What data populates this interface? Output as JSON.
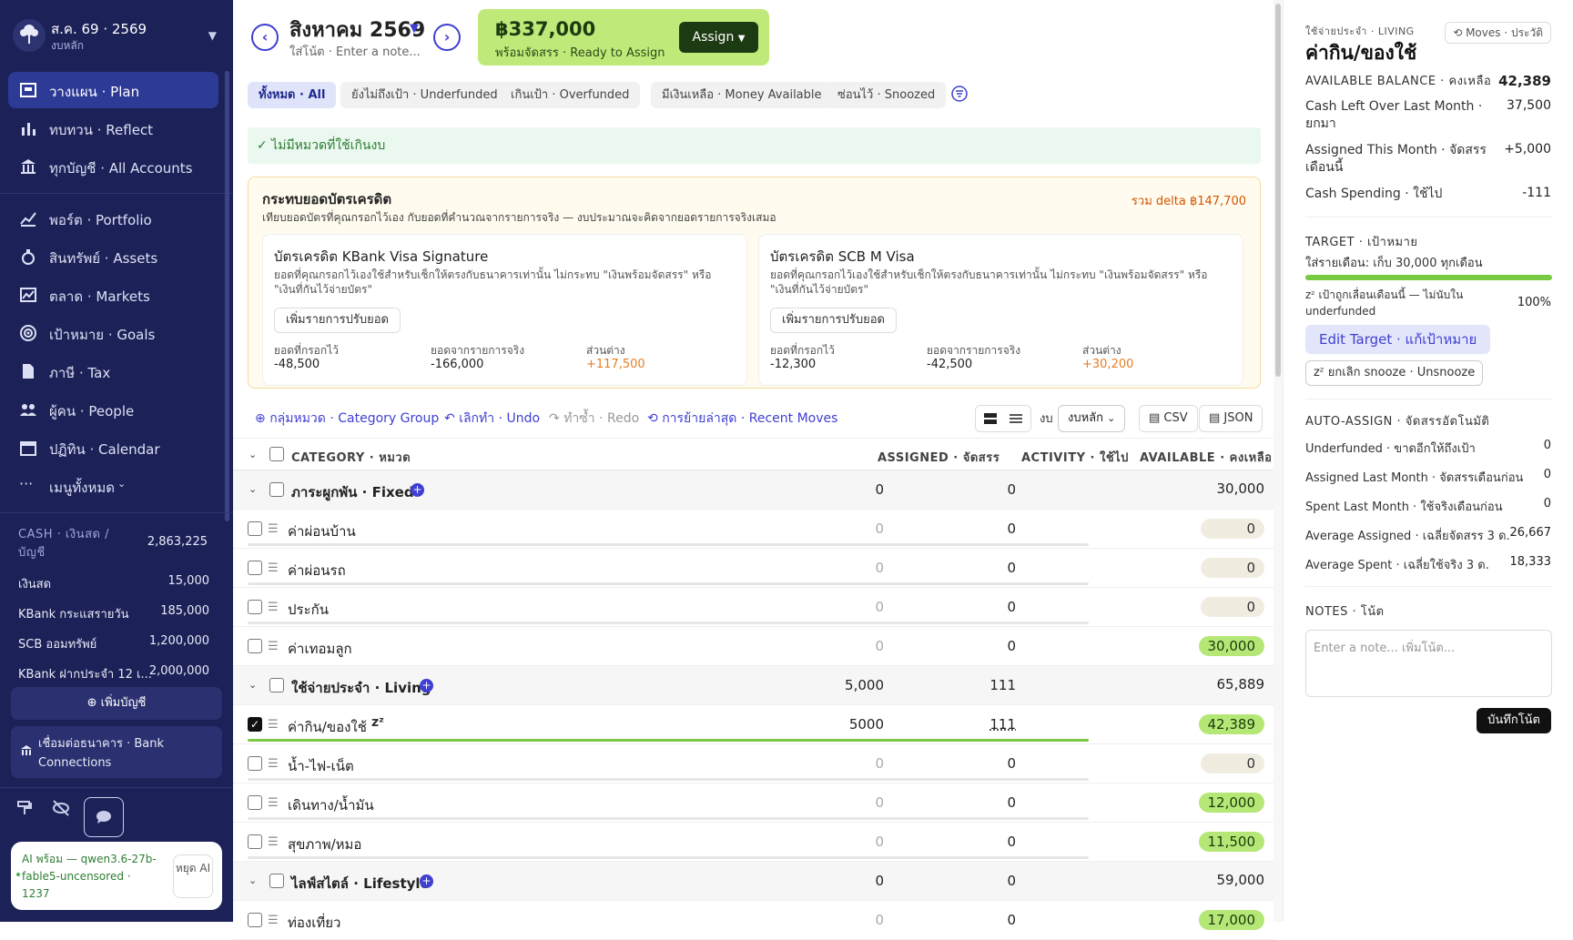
{
  "sidebar": {
    "budget_title": "ส.ค. 69 · 2569",
    "budget_sub": "งบหลัก",
    "nav_main": [
      {
        "label": "วางแผน · Plan",
        "icon": "plan-icon",
        "active": true
      },
      {
        "label": "ทบทวน · Reflect",
        "icon": "reflect-icon"
      },
      {
        "label": "ทุกบัญชี · All Accounts",
        "icon": "bank-icon"
      }
    ],
    "nav_more": [
      {
        "label": "พอร์ต · Portfolio",
        "icon": "portfolio-icon"
      },
      {
        "label": "สินทรัพย์ · Assets",
        "icon": "assets-icon"
      },
      {
        "label": "ตลาด · Markets",
        "icon": "markets-icon"
      },
      {
        "label": "เป้าหมาย · Goals",
        "icon": "goals-icon"
      },
      {
        "label": "ภาษี · Tax",
        "icon": "tax-icon"
      },
      {
        "label": "ผู้คน · People",
        "icon": "people-icon"
      },
      {
        "label": "ปฏิทิน · Calendar",
        "icon": "calendar-icon"
      },
      {
        "label": "เมนูทั้งหมด",
        "icon": "more-icon"
      }
    ],
    "cash_header": "CASH · เงินสด / บัญชี",
    "cash_total": "2,863,225",
    "accounts": [
      {
        "name": "เงินสด",
        "value": "15,000"
      },
      {
        "name": "KBank กระแสรายวัน",
        "value": "185,000"
      },
      {
        "name": "SCB ออมทรัพย์",
        "value": "1,200,000"
      },
      {
        "name": "KBank ฝากประจำ 12 เ...",
        "value": "2,000,000"
      }
    ],
    "add_account": "เพิ่มบัญชี",
    "bank_connections": "เชื่อมต่อธนาคาร · Bank Connections",
    "ai_status": "AI พร้อม — qwen3.6-27b-fable5-uncensored · 1237",
    "ai_stop": "หยุด AI"
  },
  "header": {
    "month": "สิงหาคม 2569",
    "note_placeholder": "ใส่โน้ต · Enter a note...",
    "ready_amount": "฿337,000",
    "ready_label": "พร้อมจัดสรร · Ready to Assign",
    "assign_label": "Assign"
  },
  "filters": [
    "ทั้งหมด · All",
    "ยังไม่ถึงเป้า · Underfunded",
    "เกินเป้า · Overfunded",
    "มีเงินเหลือ · Money Available",
    "ซ่อนไว้ · Snoozed"
  ],
  "ok_message": "✓ ไม่มีหมวดที่ใช้เกินงบ",
  "cc_section": {
    "title": "กระทบยอดบัตรเครดิต",
    "subtitle": "เทียบยอดบัตรที่คุณกรอกไว้เอง กับยอดที่คำนวณจากรายการจริง — งบประมาณจะคิดจากยอดรายการจริงเสมอ",
    "total_delta": "รวม delta ฿147,700",
    "cards": [
      {
        "name": "บัตรเครดิต KBank Visa Signature",
        "desc": "ยอดที่คุณกรอกไว้เองใช้สำหรับเช็กให้ตรงกับธนาคารเท่านั้น ไม่กระทบ \"เงินพร้อมจัดสรร\" หรือ \"เงินที่กันไว้จ่ายบัตร\"",
        "btn": "เพิ่มรายการปรับยอด",
        "k1": "ยอดที่กรอกไว้",
        "v1": "-48,500",
        "k2": "ยอดจากรายการจริง",
        "v2": "-166,000",
        "k3": "ส่วนต่าง",
        "v3": "+117,500"
      },
      {
        "name": "บัตรเครดิต SCB M Visa",
        "desc": "ยอดที่คุณกรอกไว้เองใช้สำหรับเช็กให้ตรงกับธนาคารเท่านั้น ไม่กระทบ \"เงินพร้อมจัดสรร\" หรือ \"เงินที่กันไว้จ่ายบัตร\"",
        "btn": "เพิ่มรายการปรับยอด",
        "k1": "ยอดที่กรอกไว้",
        "v1": "-12,300",
        "k2": "ยอดจากรายการจริง",
        "v2": "-42,500",
        "k3": "ส่วนต่าง",
        "v3": "+30,200"
      }
    ]
  },
  "toolbar": {
    "category_group": "กลุ่มหมวด · Category Group",
    "undo": "เลิกทำ · Undo",
    "redo": "ทำซ้ำ · Redo",
    "recent_moves": "การย้ายล่าสุด · Recent Moves",
    "budget_label": "งบ",
    "budget_select": "งบหลัก",
    "csv": "CSV",
    "json": "JSON"
  },
  "table": {
    "headers": {
      "category": "CATEGORY · หมวด",
      "assigned": "ASSIGNED · จัดสรร",
      "activity": "ACTIVITY · ใช้ไป",
      "available": "AVAILABLE · คงเหลือ"
    },
    "rows": [
      {
        "type": "group",
        "name": "ภาระผูกพัน · Fixed",
        "assigned": "0",
        "activity": "0",
        "available": "30,000"
      },
      {
        "type": "cat",
        "name": "ค่าผ่อนบ้าน",
        "assigned": "0",
        "activity": "0",
        "available": "0",
        "pill": "b",
        "progress": 0
      },
      {
        "type": "cat",
        "name": "ค่าผ่อนรถ",
        "assigned": "0",
        "activity": "0",
        "available": "0",
        "pill": "b",
        "progress": 0
      },
      {
        "type": "cat",
        "name": "ประกัน",
        "assigned": "0",
        "activity": "0",
        "available": "0",
        "pill": "b",
        "progress": 0
      },
      {
        "type": "cat",
        "name": "ค่าเทอมลูก",
        "assigned": "0",
        "activity": "0",
        "available": "30,000",
        "pill": "g",
        "progress": 0
      },
      {
        "type": "group",
        "name": "ใช้จ่ายประจำ · Living",
        "assigned": "5,000",
        "activity": "111",
        "available": "65,889"
      },
      {
        "type": "cat",
        "name": "ค่ากิน/ของใช้",
        "snooze": "zᶻ",
        "checked": true,
        "assigned": "5000",
        "activity": "111",
        "available": "42,389",
        "pill": "g",
        "progress": 1
      },
      {
        "type": "cat",
        "name": "น้ำ-ไฟ-เน็ต",
        "assigned": "0",
        "activity": "0",
        "available": "0",
        "pill": "b",
        "progress": 0
      },
      {
        "type": "cat",
        "name": "เดินทาง/น้ำมัน",
        "assigned": "0",
        "activity": "0",
        "available": "12,000",
        "pill": "g",
        "progress": 0
      },
      {
        "type": "cat",
        "name": "สุขภาพ/หมอ",
        "assigned": "0",
        "activity": "0",
        "available": "11,500",
        "pill": "g",
        "progress": 0
      },
      {
        "type": "group",
        "name": "ไลฟ์สไตล์ · Lifestyle",
        "assigned": "0",
        "activity": "0",
        "available": "59,000"
      },
      {
        "type": "cat",
        "name": "ท่องเที่ยว",
        "assigned": "0",
        "activity": "0",
        "available": "17,000",
        "pill": "g",
        "progress": 0
      }
    ]
  },
  "inspector": {
    "category_path": "ใช้จ่ายประจำ · LIVING",
    "title": "ค่ากิน/ของใช้",
    "moves_btn": "Moves · ประวัติ",
    "available_label": "AVAILABLE BALANCE · คงเหลือ",
    "available_value": "42,389",
    "left_over_label": "Cash Left Over Last Month · ยกมา",
    "left_over_value": "37,500",
    "assigned_label": "Assigned This Month · จัดสรรเดือนนี้",
    "assigned_value": "+5,000",
    "spending_label": "Cash Spending · ใช้ไป",
    "spending_value": "-111",
    "target_header": "TARGET · เป้าหมาย",
    "target_desc": "ใส่รายเดือน: เก็บ 30,000 ทุกเดือน",
    "target_progress": 1,
    "target_status": "zᶻ เป้าถูกเลื่อนเดือนนี้ — ไม่นับใน underfunded",
    "target_pct": "100%",
    "edit_target": "Edit Target · แก้เป้าหมาย",
    "unsnooze": "zᶻ ยกเลิก snooze · Unsnooze",
    "auto_header": "AUTO-ASSIGN · จัดสรรอัตโนมัติ",
    "auto": [
      {
        "label": "Underfunded · ขาดอีกให้ถึงเป้า",
        "value": "0"
      },
      {
        "label": "Assigned Last Month · จัดสรรเดือนก่อน",
        "value": "0"
      },
      {
        "label": "Spent Last Month · ใช้จริงเดือนก่อน",
        "value": "0"
      },
      {
        "label": "Average Assigned · เฉลี่ยจัดสรร 3 ด.",
        "value": "26,667"
      },
      {
        "label": "Average Spent · เฉลี่ยใช้จริง 3 ด.",
        "value": "18,333"
      }
    ],
    "notes_header": "NOTES · โน้ต",
    "notes_placeholder": "Enter a note... เพิ่มโน้ต...",
    "save_note": "บันทึกโน้ต"
  },
  "colors": {
    "sidebar": "#1c2258",
    "accent": "#3f3fd1",
    "ready": "#bfea79",
    "positive": "#b5e776"
  }
}
